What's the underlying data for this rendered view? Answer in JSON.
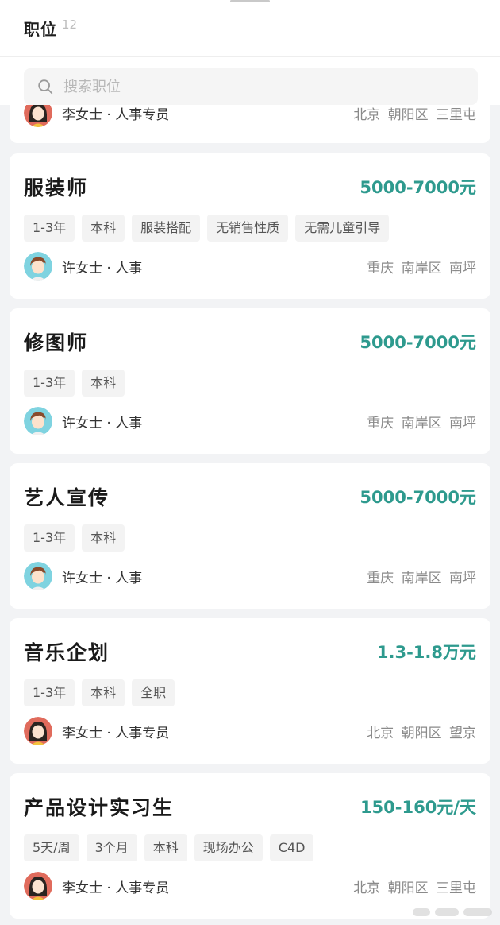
{
  "header": {
    "title": "职位",
    "count": "12"
  },
  "search": {
    "placeholder": "搜索职位",
    "value": ""
  },
  "partial_card": {
    "recruiter": "李女士 · 人事专员",
    "location": "北京 朝阳区 三里屯",
    "avatar_icon": "female-avatar-icon"
  },
  "jobs": [
    {
      "title": "服装师",
      "salary": "5000-7000元",
      "tags": [
        "1-3年",
        "本科",
        "服装搭配",
        "无销售性质",
        "无需儿童引导"
      ],
      "recruiter": "许女士 · 人事",
      "location": "重庆 南岸区 南坪",
      "avatar_icon": "male-avatar-icon"
    },
    {
      "title": "修图师",
      "salary": "5000-7000元",
      "tags": [
        "1-3年",
        "本科"
      ],
      "recruiter": "许女士 · 人事",
      "location": "重庆 南岸区 南坪",
      "avatar_icon": "male-avatar-icon"
    },
    {
      "title": "艺人宣传",
      "salary": "5000-7000元",
      "tags": [
        "1-3年",
        "本科"
      ],
      "recruiter": "许女士 · 人事",
      "location": "重庆 南岸区 南坪",
      "avatar_icon": "male-avatar-icon"
    },
    {
      "title": "音乐企划",
      "salary": "1.3-1.8万元",
      "tags": [
        "1-3年",
        "本科",
        "全职"
      ],
      "recruiter": "李女士 · 人事专员",
      "location": "北京 朝阳区 望京",
      "avatar_icon": "female-avatar-icon"
    },
    {
      "title": "产品设计实习生",
      "salary": "150-160元/天",
      "tags": [
        "5天/周",
        "3个月",
        "本科",
        "现场办公",
        "C4D"
      ],
      "recruiter": "李女士 · 人事专员",
      "location": "北京 朝阳区 三里屯",
      "avatar_icon": "female-avatar-icon"
    }
  ],
  "colors": {
    "salary": "#2e9a8e",
    "background": "#f2f3f5",
    "card": "#ffffff",
    "tag_bg": "#f3f3f3"
  }
}
